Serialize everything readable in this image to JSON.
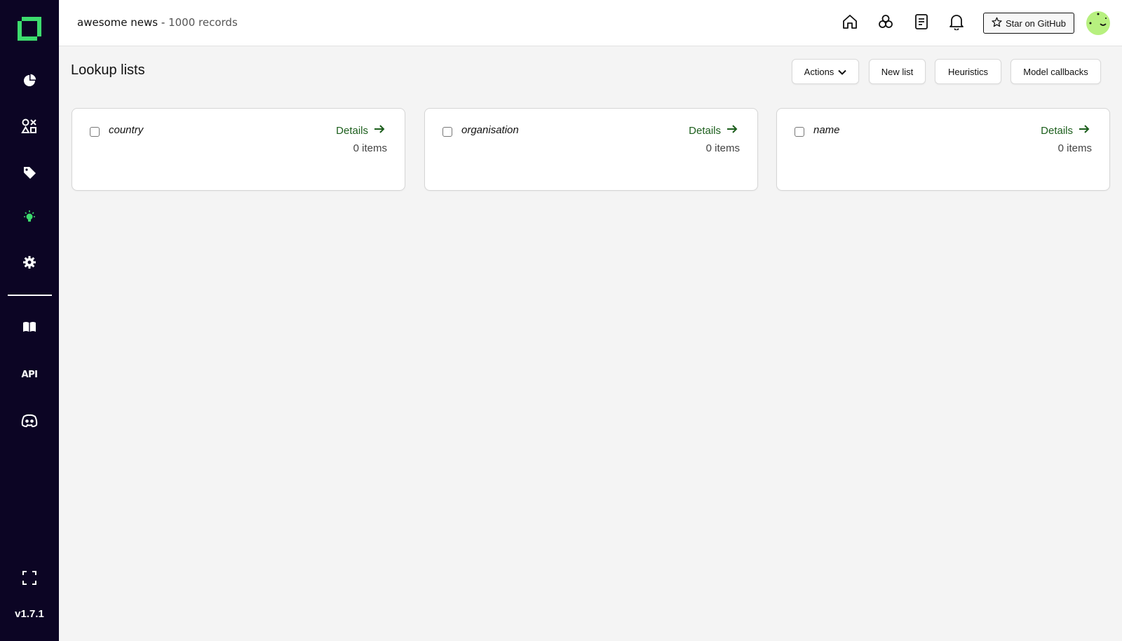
{
  "app": {
    "version": "v1.7.1",
    "brand_color": "#3ddc6e",
    "sidebar_bg": "#0c0524"
  },
  "sidebar": {
    "items": [
      {
        "icon": "pie-chart-icon",
        "label": "Overview"
      },
      {
        "icon": "shapes-icon",
        "label": "Data browser"
      },
      {
        "icon": "tag-icon",
        "label": "Labeling"
      },
      {
        "icon": "lightbulb-icon",
        "label": "Heuristics",
        "active": true
      },
      {
        "icon": "gear-icon",
        "label": "Settings"
      }
    ],
    "bottom_items": [
      {
        "icon": "book-icon",
        "label": "Documentation"
      },
      {
        "icon": "api-icon",
        "label": "API"
      },
      {
        "icon": "discord-icon",
        "label": "Discord"
      }
    ],
    "api_text": "API",
    "fullscreen_icon": "fullscreen-icon"
  },
  "header": {
    "project_name": "awesome news",
    "separator": "-",
    "record_count": "1000 records",
    "icons": [
      "home-icon",
      "models-icon",
      "document-icon",
      "bell-icon"
    ],
    "github_button": "Star on GitHub"
  },
  "page": {
    "title": "Lookup lists",
    "actions_label": "Actions",
    "new_list_label": "New list",
    "heuristics_label": "Heuristics",
    "model_callbacks_label": "Model callbacks"
  },
  "lists": [
    {
      "name": "country",
      "details": "Details",
      "count": "0 items"
    },
    {
      "name": "organisation",
      "details": "Details",
      "count": "0 items"
    },
    {
      "name": "name",
      "details": "Details",
      "count": "0 items"
    }
  ]
}
